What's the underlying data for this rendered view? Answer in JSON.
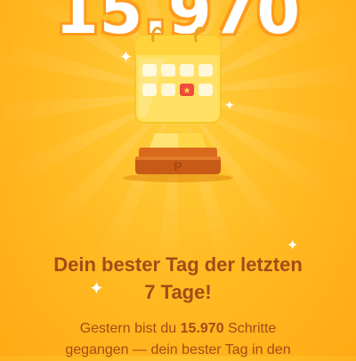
{
  "hero": {
    "steps_value": "15.970"
  },
  "headline": {
    "line1": "Dein bester Tag der letzten",
    "line2": "7 Tage!"
  },
  "description": {
    "prefix": "Gestern bist du ",
    "highlight": "15.970",
    "suffix": " Schritte",
    "line2": "gegangen — dein bester Tag in den"
  },
  "trophy": {
    "icon": "calendar-trophy-icon",
    "badge_icon": "star-icon",
    "base_glyph": "P"
  },
  "colors": {
    "background": "#ffbc24",
    "text": "#a34c17",
    "number_outline": "#ff9a1c",
    "trophy_gold": "#ffd84a",
    "trophy_base": "#c65a16",
    "highlight_cell": "#ef4a3b"
  }
}
